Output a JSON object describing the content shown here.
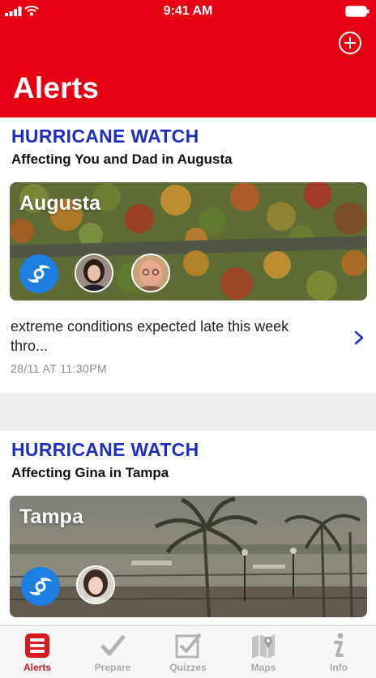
{
  "status_bar": {
    "time": "9:41 AM"
  },
  "header": {
    "title": "Alerts",
    "add_icon": "plus-circle-icon"
  },
  "alerts": [
    {
      "type": "HURRICANE WATCH",
      "affecting": "Affecting You and Dad in Augusta",
      "city": "Augusta",
      "message": "extreme conditions expected late this week thro...",
      "timestamp": "28/11 AT 11:30PM"
    },
    {
      "type": "HURRICANE WATCH",
      "affecting": "Affecting Gina in Tampa",
      "city": "Tampa"
    }
  ],
  "tabs": [
    {
      "label": "Alerts",
      "icon": "alerts-list-icon",
      "active": true
    },
    {
      "label": "Prepare",
      "icon": "checkmark-icon",
      "active": false
    },
    {
      "label": "Quizzes",
      "icon": "checkbox-icon",
      "active": false
    },
    {
      "label": "Maps",
      "icon": "map-icon",
      "active": false
    },
    {
      "label": "Info",
      "icon": "info-icon",
      "active": false
    }
  ],
  "colors": {
    "brand_red": "#e60012",
    "alert_blue": "#1c2fbd",
    "hurricane_badge": "#1b7ee0",
    "tab_active": "#d71920",
    "tab_inactive": "#a9a9a9"
  }
}
